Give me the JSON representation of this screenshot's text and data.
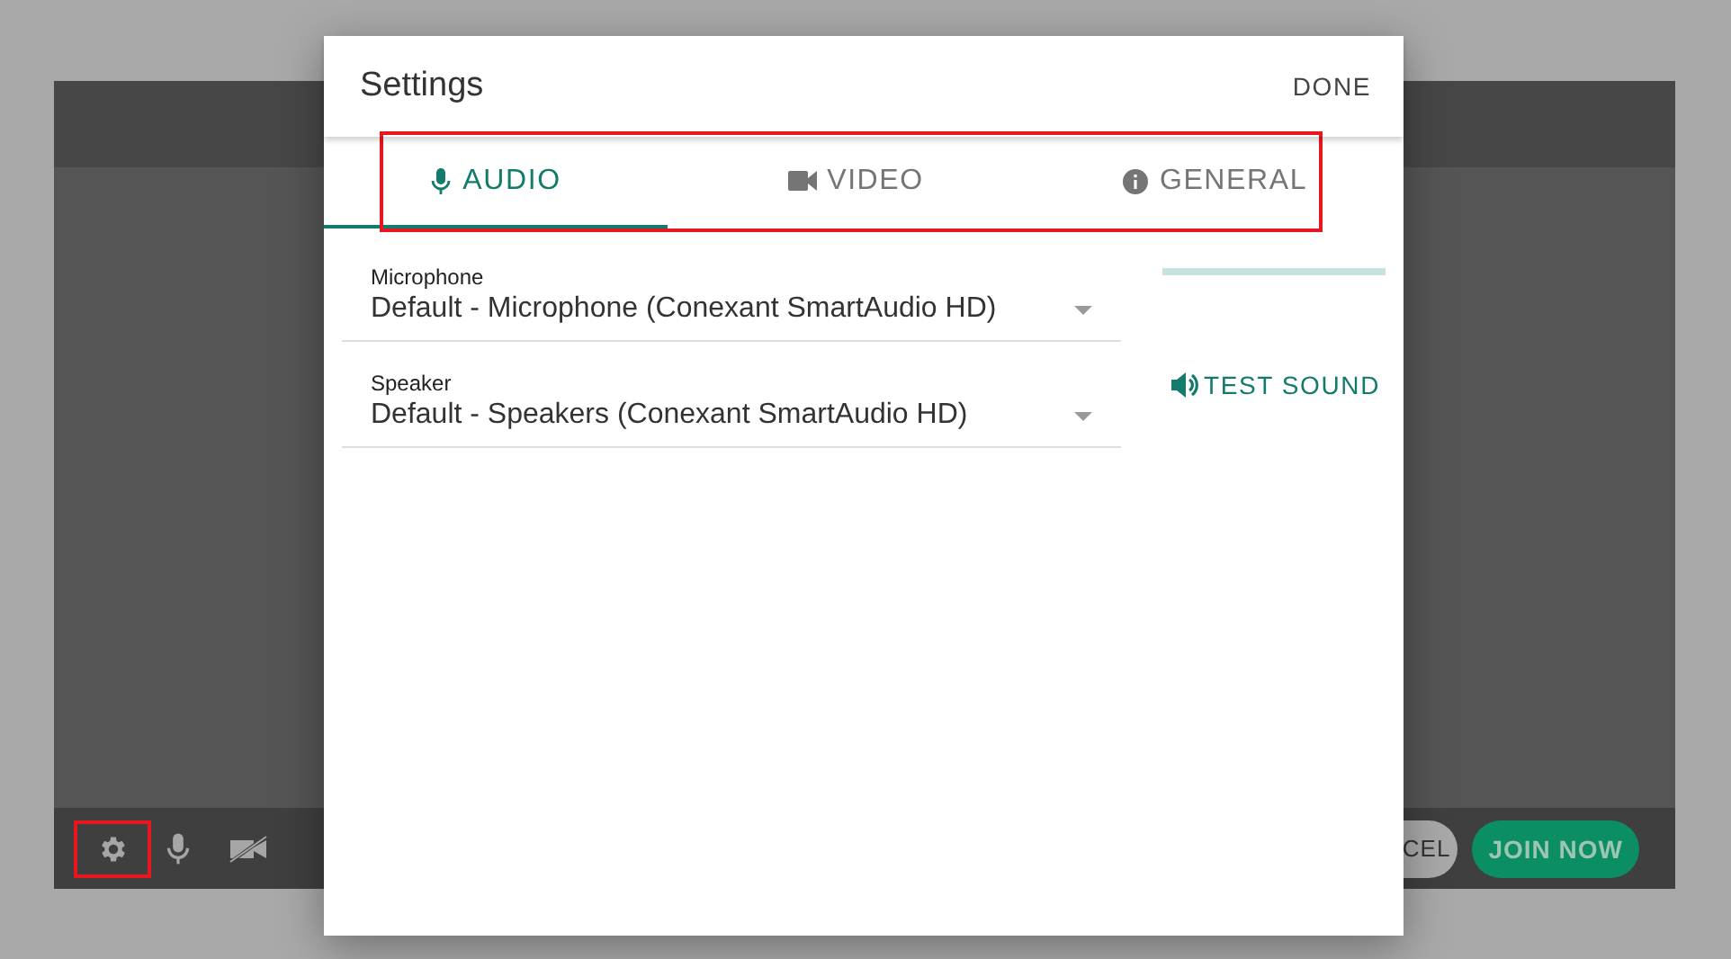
{
  "settings_dialog": {
    "title": "Settings",
    "done_button": "DONE",
    "tabs": [
      {
        "kind": "audio",
        "label": "AUDIO",
        "selected": true
      },
      {
        "kind": "video",
        "label": "VIDEO",
        "selected": false
      },
      {
        "kind": "general",
        "label": "GENERAL",
        "selected": false
      }
    ],
    "fields": [
      {
        "label": "Microphone",
        "value": "Default - Microphone (Conexant SmartAudio HD)"
      },
      {
        "label": "Speaker",
        "value": "Default - Speakers (Conexant SmartAudio HD)"
      }
    ],
    "mic_level": {
      "level": 0
    },
    "test_sound_button": "TEST SOUND"
  },
  "toolbar": {
    "cancel_button": "CEL",
    "join_button": "JOIN NOW"
  }
}
